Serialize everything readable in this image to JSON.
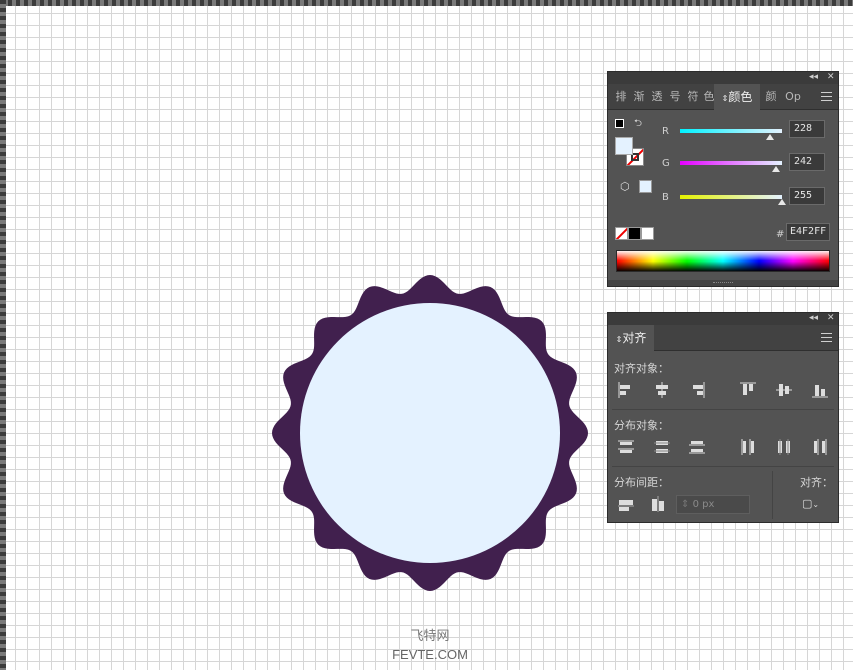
{
  "color_panel": {
    "tabs": [
      "排",
      "渐",
      "透",
      "号",
      "符",
      "色",
      "颜色",
      "颜",
      "Op"
    ],
    "active_tab": "颜色",
    "channels": [
      {
        "label": "R",
        "value": "228",
        "slider_fraction": 0.894
      },
      {
        "label": "G",
        "value": "242",
        "slider_fraction": 0.949
      },
      {
        "label": "B",
        "value": "255",
        "slider_fraction": 1.0
      }
    ],
    "hex_label": "#",
    "hex_value": "E4F2FF",
    "fill_color": "#E4F2FF",
    "collapse_icon": "double-chevron-icon",
    "close_icon": "close-icon"
  },
  "align_panel": {
    "tab": "对齐",
    "align_objects_label": "对齐对象：",
    "distribute_objects_label": "分布对象：",
    "distribute_spacing_label": "分布间距：",
    "align_to_label": "对齐：",
    "spacing_value": "0 px"
  },
  "artwork": {
    "badge_outer_color": "#41204E",
    "badge_inner_color": "#E4F2FF"
  },
  "watermark": {
    "line1": "飞特网",
    "line2": "FEVTE.COM"
  }
}
